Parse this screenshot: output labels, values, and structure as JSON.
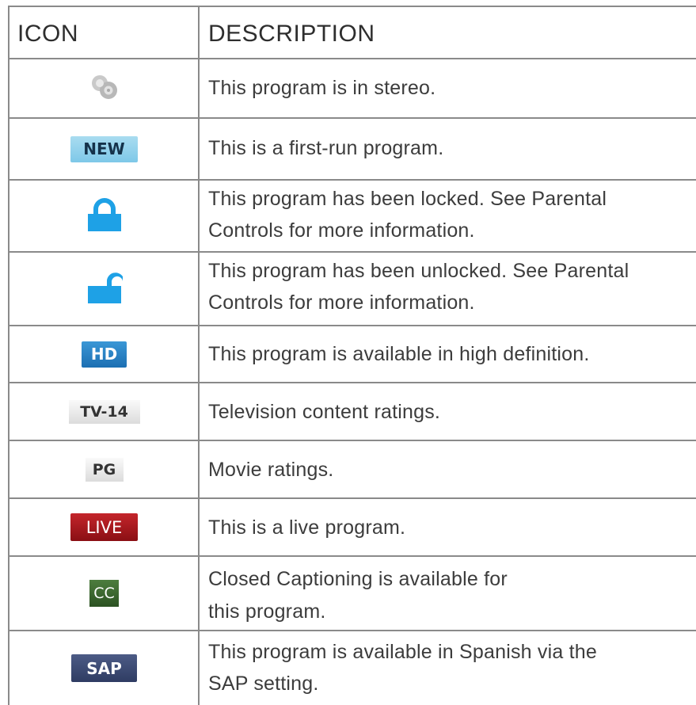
{
  "header": {
    "icon_col": "ICON",
    "desc_col": "DESCRIPTION"
  },
  "rows": [
    {
      "icon": "stereo-icon",
      "badge": "",
      "lines": [
        "This program is in stereo."
      ]
    },
    {
      "icon": "new-badge",
      "badge": "NEW",
      "lines": [
        "This is a first-run program."
      ]
    },
    {
      "icon": "lock-closed-icon",
      "badge": "",
      "lines": [
        "This program has been locked. See Parental",
        "Controls for more information."
      ]
    },
    {
      "icon": "lock-open-icon",
      "badge": "",
      "lines": [
        "This program has been unlocked. See Parental",
        "Controls for more information."
      ]
    },
    {
      "icon": "hd-badge",
      "badge": "HD",
      "lines": [
        "This program is available in high definition."
      ]
    },
    {
      "icon": "tv14-badge",
      "badge": "TV-14",
      "lines": [
        "Television content ratings."
      ]
    },
    {
      "icon": "pg-badge",
      "badge": "PG",
      "lines": [
        "Movie ratings."
      ]
    },
    {
      "icon": "live-badge",
      "badge": "LIVE",
      "lines": [
        "This is a live program."
      ]
    },
    {
      "icon": "cc-badge",
      "badge": "CC",
      "lines": [
        "Closed Captioning is available for",
        "this program."
      ]
    },
    {
      "icon": "sap-badge",
      "badge": "SAP",
      "lines": [
        "This program is available in Spanish via the",
        "SAP setting."
      ]
    }
  ],
  "colors": {
    "border": "#8a8a8a",
    "text": "#3c3c3c",
    "lock_blue": "#1ea1e6"
  }
}
